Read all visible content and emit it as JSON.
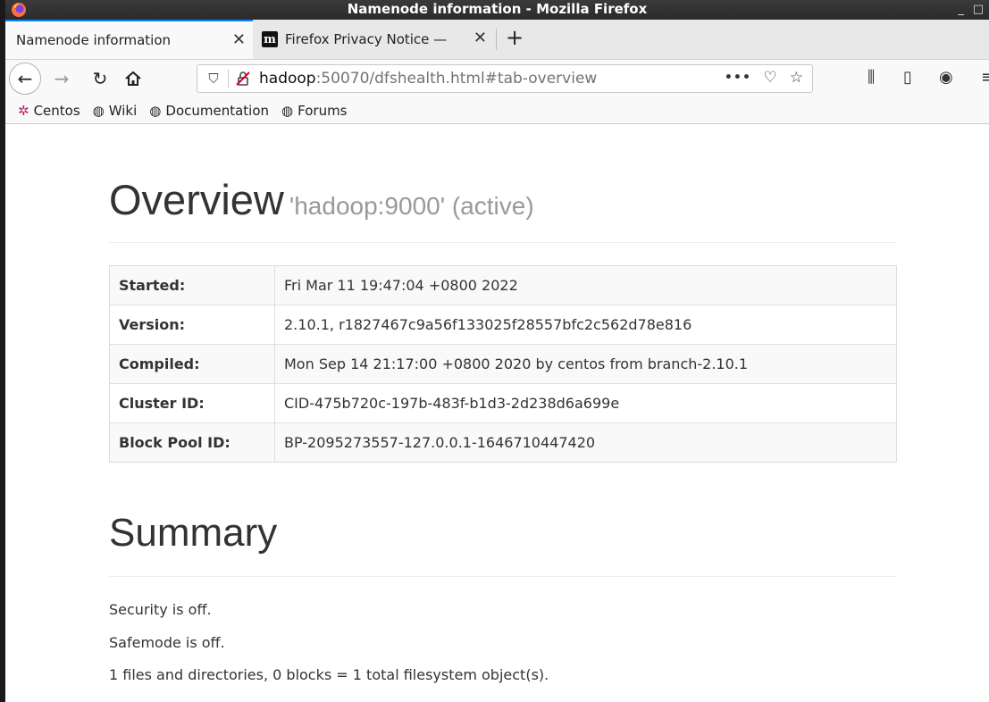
{
  "window": {
    "title": "Namenode information - Mozilla Firefox",
    "controls": {
      "minimize": "_",
      "maximize": "□"
    }
  },
  "tabs": [
    {
      "label": "Namenode information",
      "active": true
    },
    {
      "label": "Firefox Privacy Notice — ",
      "active": false,
      "favicon": "m"
    }
  ],
  "toolbar": {
    "url_host": "hadoop",
    "url_rest": ":50070/dfshealth.html#tab-overview",
    "page_actions_glyph": "•••"
  },
  "bookmarks": [
    {
      "label": "Centos",
      "icon": "centos-icon"
    },
    {
      "label": "Wiki",
      "icon": "globe-icon"
    },
    {
      "label": "Documentation",
      "icon": "globe-icon"
    },
    {
      "label": "Forums",
      "icon": "globe-icon"
    }
  ],
  "overview": {
    "title": "Overview",
    "subtitle": "'hadoop:9000' (active)",
    "rows": [
      {
        "key": "Started:",
        "value": "Fri Mar 11 19:47:04 +0800 2022"
      },
      {
        "key": "Version:",
        "value": "2.10.1, r1827467c9a56f133025f28557bfc2c562d78e816"
      },
      {
        "key": "Compiled:",
        "value": "Mon Sep 14 21:17:00 +0800 2020 by centos from branch-2.10.1"
      },
      {
        "key": "Cluster ID:",
        "value": "CID-475b720c-197b-483f-b1d3-2d238d6a699e"
      },
      {
        "key": "Block Pool ID:",
        "value": "BP-2095273557-127.0.0.1-1646710447420"
      }
    ]
  },
  "summary": {
    "title": "Summary",
    "lines": [
      "Security is off.",
      "Safemode is off.",
      "1 files and directories, 0 blocks = 1 total filesystem object(s)."
    ]
  },
  "colors": {
    "accent": "#0a84ff",
    "insecure": "#d70022"
  }
}
